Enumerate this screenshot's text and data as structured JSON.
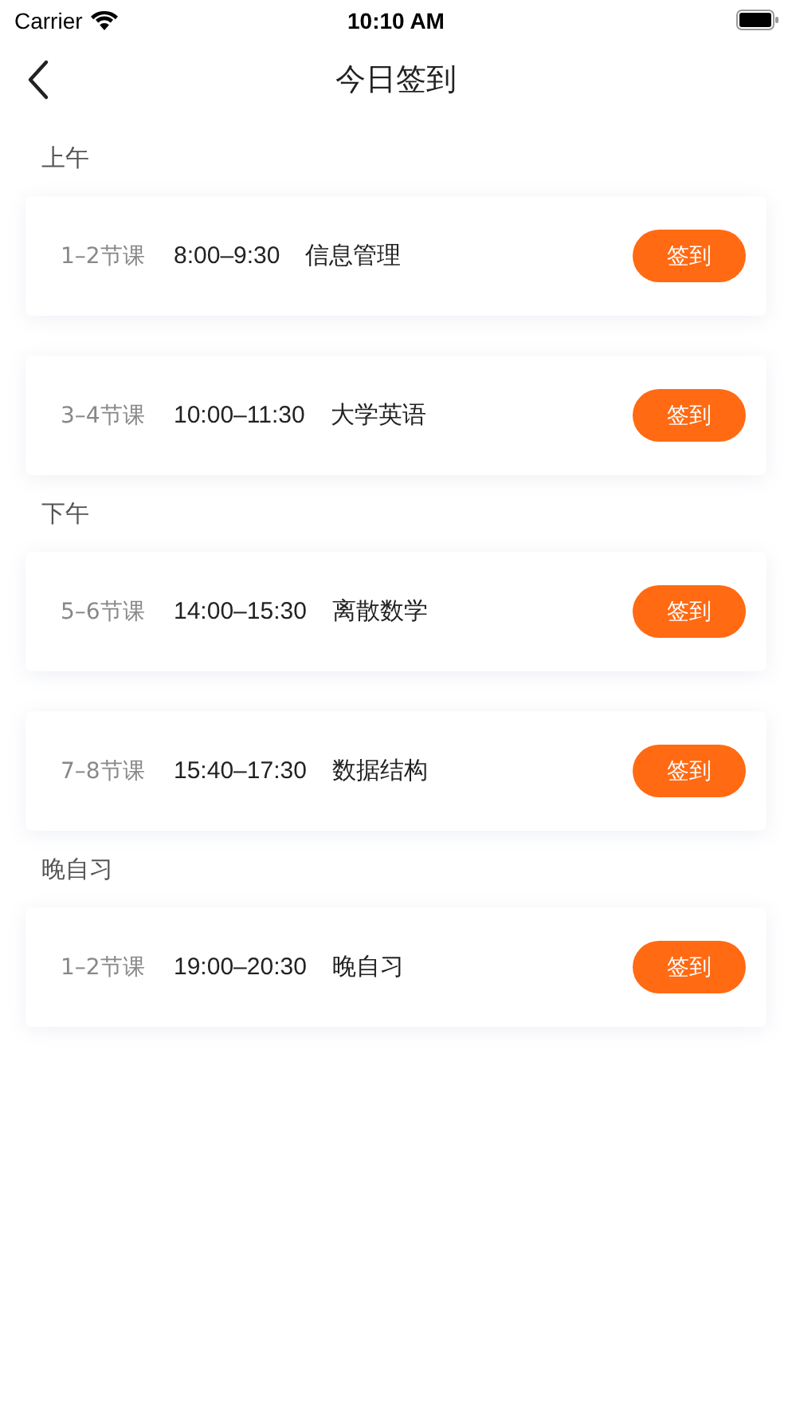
{
  "status_bar": {
    "carrier": "Carrier",
    "time": "10:10 AM"
  },
  "nav": {
    "title": "今日签到"
  },
  "sections": [
    {
      "title": "上午",
      "lessons": [
        {
          "period": "1–2节课",
          "time": "8:00–9:30",
          "subject": "信息管理",
          "button": "签到"
        },
        {
          "period": "3–4节课",
          "time": "10:00–11:30",
          "subject": "大学英语",
          "button": "签到"
        }
      ]
    },
    {
      "title": "下午",
      "lessons": [
        {
          "period": "5–6节课",
          "time": "14:00–15:30",
          "subject": "离散数学",
          "button": "签到"
        },
        {
          "period": "7–8节课",
          "time": "15:40–17:30",
          "subject": "数据结构",
          "button": "签到"
        }
      ]
    },
    {
      "title": "晚自习",
      "lessons": [
        {
          "period": "1–2节课",
          "time": "19:00–20:30",
          "subject": "晚自习",
          "button": "签到"
        }
      ]
    }
  ]
}
